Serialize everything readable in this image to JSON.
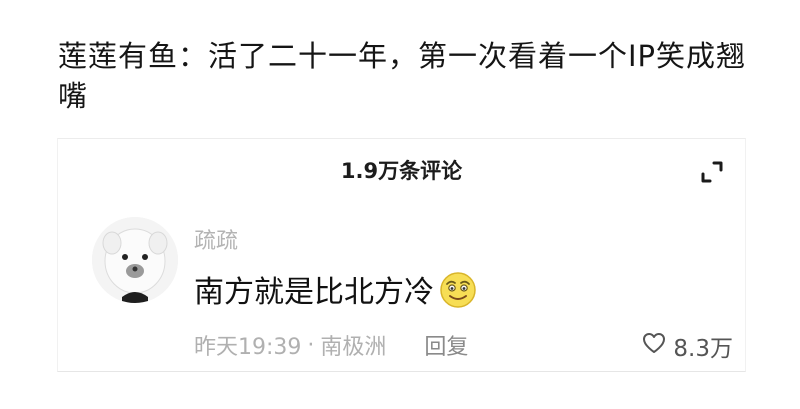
{
  "post": {
    "text": "莲莲有鱼：活了二十一年，第一次看着一个IP笑成翘嘴"
  },
  "comments_panel": {
    "title": "1.9万条评论",
    "expand_icon": "expand-icon"
  },
  "comment": {
    "username": "疏疏",
    "text": "南方就是比北方冷",
    "emoji_icon": "smiling-face-emoji",
    "time": "昨天19:39",
    "location": "南极洲",
    "separator": "·",
    "reply_label": "回复",
    "like_icon": "heart-icon",
    "like_count": "8.3万"
  }
}
